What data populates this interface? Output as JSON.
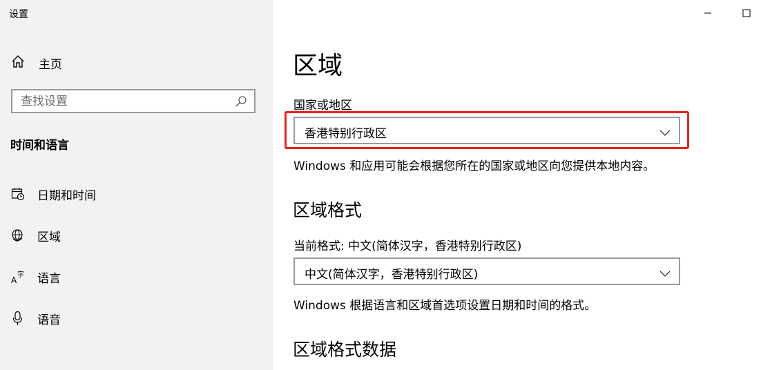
{
  "window": {
    "title": "设置",
    "controls": {
      "minimize_icon": "minimize-icon",
      "maximize_icon": "maximize-icon"
    }
  },
  "sidebar": {
    "home_label": "主页",
    "search": {
      "placeholder": "查找设置"
    },
    "section_title": "时间和语言",
    "items": [
      {
        "label": "日期和时间",
        "icon": "calendar-clock-icon"
      },
      {
        "label": "区域",
        "icon": "globe-icon"
      },
      {
        "label": "语言",
        "icon": "language-icon"
      },
      {
        "label": "语音",
        "icon": "microphone-icon"
      }
    ]
  },
  "main": {
    "title": "区域",
    "country_label": "国家或地区",
    "country_value": "香港特别行政区",
    "country_desc": "Windows 和应用可能会根据您所在的国家或地区向您提供本地内容。",
    "format_heading": "区域格式",
    "format_current": "当前格式: 中文(简体汉字，香港特别行政区)",
    "format_value": "中文(简体汉字，香港特别行政区)",
    "format_desc": "Windows 根据语言和区域首选项设置日期和时间的格式。",
    "format_data_heading": "区域格式数据"
  },
  "colors": {
    "highlight": "#e8231b",
    "sidebar_bg": "#f2f2f2",
    "border": "#9a9a9a"
  }
}
